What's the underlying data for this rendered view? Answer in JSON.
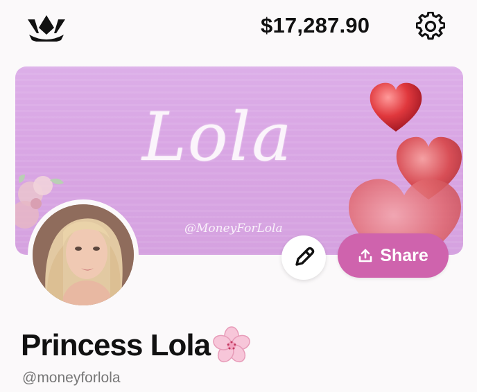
{
  "header": {
    "logo_icon": "crown-icon",
    "balance": "$17,287.90",
    "settings_icon": "gear-icon"
  },
  "banner": {
    "script_title": "Lola",
    "watermark": "@MoneyForLola",
    "background_color": "#d9a6e4",
    "decor_icons": [
      "heart-icon",
      "flower-icon"
    ]
  },
  "actions": {
    "edit_icon": "pencil-icon",
    "share_label": "Share",
    "share_icon": "upload-icon",
    "share_color": "#cf63ad"
  },
  "profile": {
    "display_name": "Princess Lola",
    "name_emoji_icon": "cherry-blossom-icon",
    "handle": "@moneyforlola"
  }
}
